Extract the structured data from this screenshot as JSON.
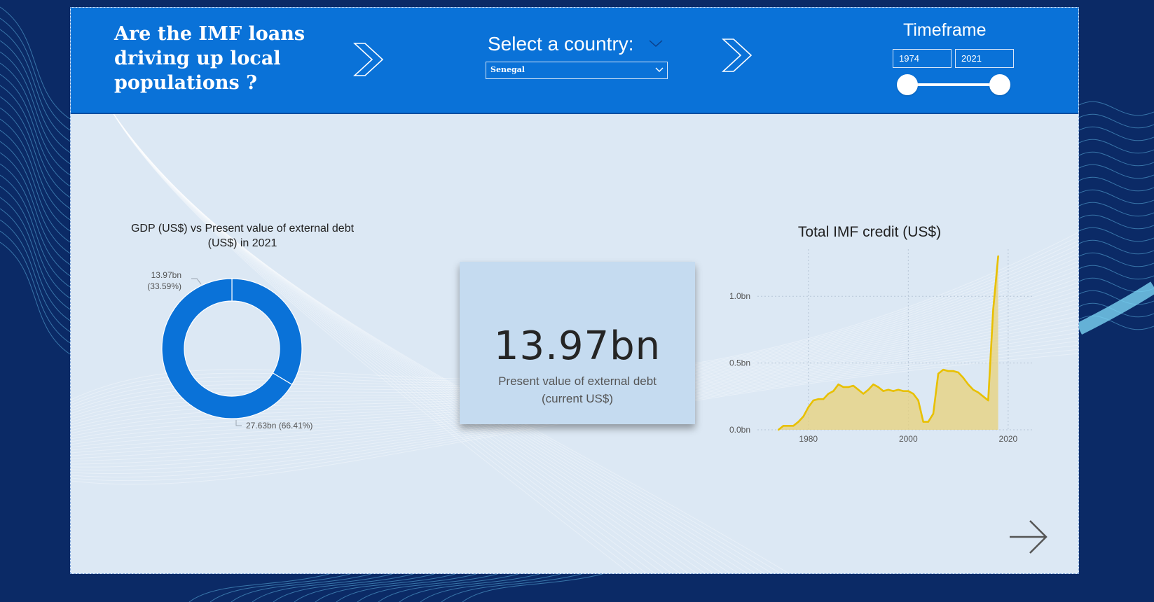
{
  "header": {
    "title_lines": [
      "Are the IMF loans",
      "driving up local",
      "populations ?"
    ],
    "select_label": "Select a country:",
    "country_value": "Senegal",
    "timeframe": {
      "title": "Timeframe",
      "start": "1974",
      "end": "2021",
      "start_fraction": 0,
      "end_fraction": 1
    }
  },
  "donut": {
    "title_lines": [
      "GDP (US$) vs Present value of external debt",
      "(US$) in 2021"
    ],
    "label_small": [
      "13.97bn",
      "(33.59%)"
    ],
    "label_large": "27.63bn (66.41%)"
  },
  "kpi": {
    "value": "13.97bn",
    "label_lines": [
      "Present value of external debt",
      "(current US$)"
    ]
  },
  "colors": {
    "header": "#0a72d8",
    "donut": "#0a72d8",
    "area_fill": "#e8d27a",
    "area_line": "#e8c000",
    "page_bg": "#0b2a66"
  },
  "icons": [
    "chevron-right-icon",
    "chevron-down-icon",
    "arrow-right-icon"
  ],
  "chart_data": [
    {
      "type": "pie",
      "title": "GDP (US$) vs Present value of external debt (US$) in 2021",
      "categories": [
        "Present value of external debt",
        "GDP"
      ],
      "values": [
        13.97,
        27.63
      ],
      "percent": [
        33.59,
        66.41
      ],
      "units": "bn"
    },
    {
      "type": "area",
      "title": "Total IMF credit (US$)",
      "x": [
        1974,
        1975,
        1976,
        1977,
        1978,
        1979,
        1980,
        1981,
        1982,
        1983,
        1984,
        1985,
        1986,
        1987,
        1988,
        1989,
        1990,
        1991,
        1992,
        1993,
        1994,
        1995,
        1996,
        1997,
        1998,
        1999,
        2000,
        2001,
        2002,
        2003,
        2004,
        2005,
        2006,
        2007,
        2008,
        2009,
        2010,
        2011,
        2012,
        2013,
        2014,
        2015,
        2016,
        2017,
        2018,
        2019,
        2020,
        2021
      ],
      "values": [
        0.0,
        0.03,
        0.03,
        0.03,
        0.06,
        0.1,
        0.17,
        0.22,
        0.23,
        0.23,
        0.27,
        0.29,
        0.34,
        0.32,
        0.32,
        0.33,
        0.3,
        0.27,
        0.3,
        0.34,
        0.32,
        0.29,
        0.3,
        0.29,
        0.3,
        0.29,
        0.29,
        0.27,
        0.22,
        0.06,
        0.06,
        0.12,
        0.42,
        0.45,
        0.44,
        0.44,
        0.43,
        0.39,
        0.34,
        0.3,
        0.28,
        0.25,
        0.22,
        0.9,
        1.3
      ],
      "xticks": [
        "1980",
        "2000",
        "2020"
      ],
      "yticks": [
        "0.0bn",
        "0.5bn",
        "1.0bn"
      ],
      "ylim": [
        0,
        1.3
      ],
      "xlim": [
        1974,
        2021
      ],
      "grid": true
    }
  ]
}
